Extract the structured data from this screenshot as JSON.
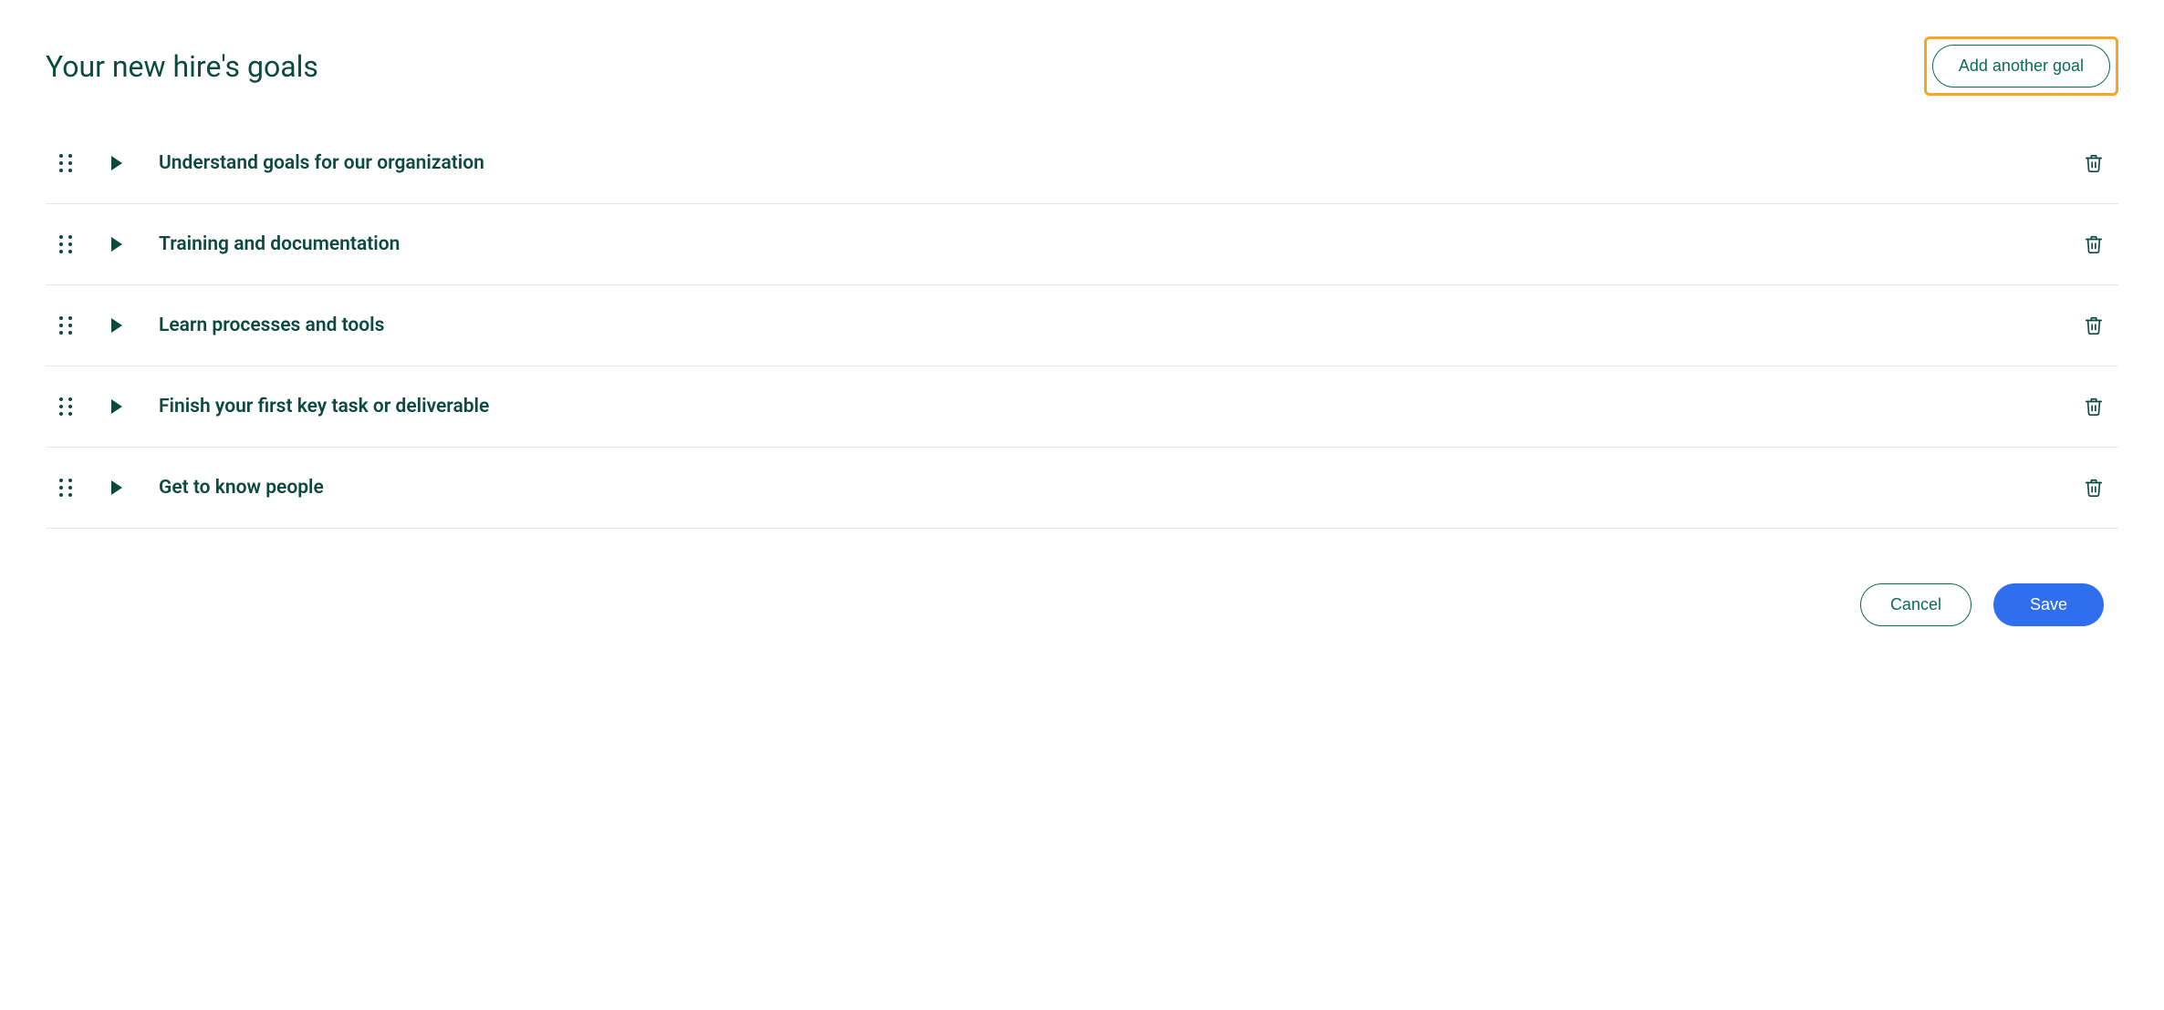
{
  "header": {
    "title": "Your new hire's goals",
    "add_button_label": "Add another goal"
  },
  "goals": [
    {
      "title": "Understand goals for our organization"
    },
    {
      "title": "Training and documentation"
    },
    {
      "title": "Learn processes and tools"
    },
    {
      "title": "Finish your first key task or deliverable"
    },
    {
      "title": "Get to know people"
    }
  ],
  "footer": {
    "cancel_label": "Cancel",
    "save_label": "Save"
  }
}
